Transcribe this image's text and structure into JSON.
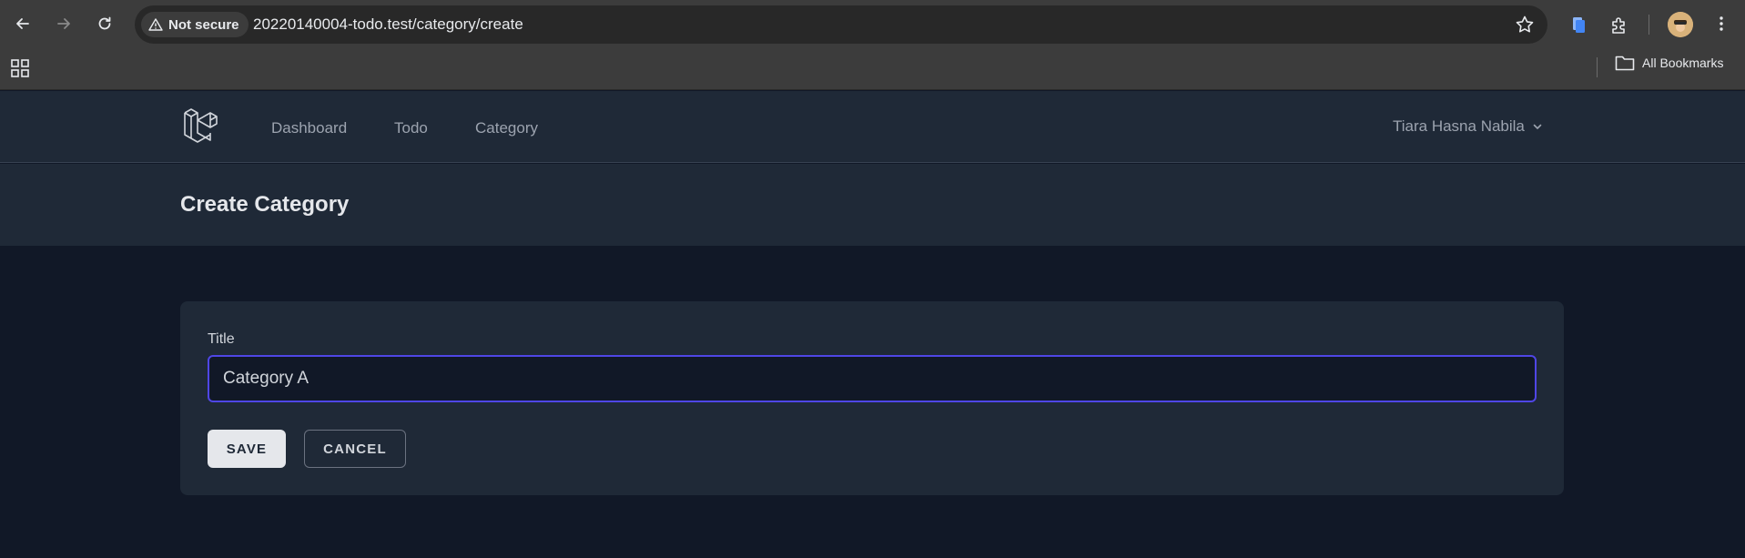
{
  "browser": {
    "security_label": "Not secure",
    "url": "20220140004-todo.test/category/create",
    "bookmarks_label": "All Bookmarks"
  },
  "nav": {
    "links": [
      "Dashboard",
      "Todo",
      "Category"
    ],
    "user_name": "Tiara Hasna Nabila"
  },
  "header": {
    "title": "Create Category"
  },
  "form": {
    "title_label": "Title",
    "title_value": "Category A",
    "save_label": "SAVE",
    "cancel_label": "CANCEL"
  },
  "colors": {
    "nav_bg": "#1f2937",
    "page_bg": "#111827",
    "focus_ring": "#4f46e5"
  }
}
